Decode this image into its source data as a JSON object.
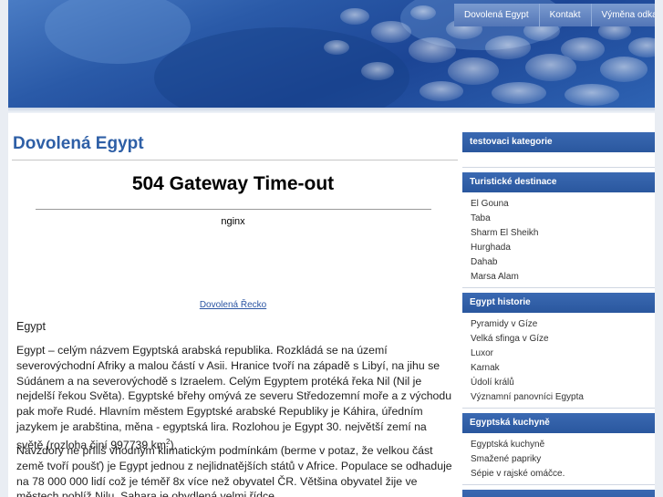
{
  "nav": {
    "items": [
      "Dovolená Egypt",
      "Kontakt",
      "Výměna odkazů"
    ]
  },
  "main": {
    "title": "Dovolená Egypt",
    "error_title": "504 Gateway Time-out",
    "error_server": "nginx",
    "link_greece": "Dovolená Řecko",
    "heading": "Egypt",
    "para1_text": "Egypt – celým názvem Egyptská arabská republika. Rozkládá se na území severovýchodní Afriky a malou částí v Asii. Hranice tvoří na západě s Libyí, na jihu se Súdánem a na severovýchodě s Izraelem. Celým Egyptem protéká řeka Nil (Nil je nejdelší řekou Světa). Egyptské břehy omývá ze severu Středozemní moře a z východu pak moře Rudé. Hlavním městem Egyptské arabské Republiky je Káhira, úředním jazykem je arabština, měna - egyptská lira. Rozlohou je Egypt 30. největší zemí na světě (rozloha činí 997739 km",
    "para1_sup": "2",
    "para1_end": ").",
    "para2": "Navzdory ne příliš vhodným klimatickým podmínkám (berme v potaz, že velkou část země tvoří poušť) je Egypt jednou z nejlidnatějších států v Africe. Populace se odhaduje na 78 000 000 lidí což je téměř 8x více než obyvatel ČR. Většina obyvatel žije ve městech poblíž Nilu. Sahara je obydlená velmi řídce."
  },
  "sidebar": {
    "sections": [
      {
        "title": "testovaci kategorie",
        "items": []
      },
      {
        "title": "Turistické destinace",
        "items": [
          "El Gouna",
          "Taba",
          "Sharm El Sheikh",
          "Hurghada",
          "Dahab",
          "Marsa Alam"
        ]
      },
      {
        "title": "Egypt historie",
        "items": [
          "Pyramidy v Gíze",
          "Velká sfinga v Gíze",
          "Luxor",
          "Karnak",
          "Údolí králů",
          "Významní panovníci Egypta"
        ]
      },
      {
        "title": "Egyptská kuchyně",
        "items": [
          "Egyptská kuchyně",
          "Smažené papriky",
          "Sépie v rajské omáčce."
        ]
      }
    ]
  },
  "colors": {
    "accent": "#2e5fa6",
    "header_blue": "#2a5aa8",
    "sidebar_head": "#2a579e",
    "link": "#2b55a3"
  }
}
